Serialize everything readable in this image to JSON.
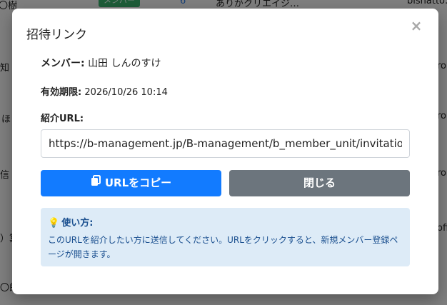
{
  "background": {
    "badge": "メンバー",
    "fragments": [
      "〇樹",
      "6",
      "ありがクリエイジ…",
      "bishatto…",
      "知",
      "ほ",
      "信",
      "）算",
      "〇郎",
      "ro",
      "ro",
      "ofi",
      "ro"
    ]
  },
  "modal": {
    "title": "招待リンク",
    "close_label": "×",
    "member_label": "メンバー:",
    "member_value": "山田 しんのすけ",
    "expiry_label": "有効期限:",
    "expiry_value": "2026/10/26 10:14",
    "link_label": "紹介URL:",
    "url_value": "https://b-management.jp/B-management/b_member_unit/invitation.php",
    "copy_button": "URLをコピー",
    "close_button": "閉じる",
    "help_title": "使い方:",
    "help_text": "このURLを紹介したい方に送信してください。URLをクリックすると、新規メンバー登録ページが開きます。"
  },
  "colors": {
    "primary": "#127bff",
    "secondary": "#6c757d",
    "info_bg": "#ddebf7",
    "info_text": "#1a4f8f"
  }
}
